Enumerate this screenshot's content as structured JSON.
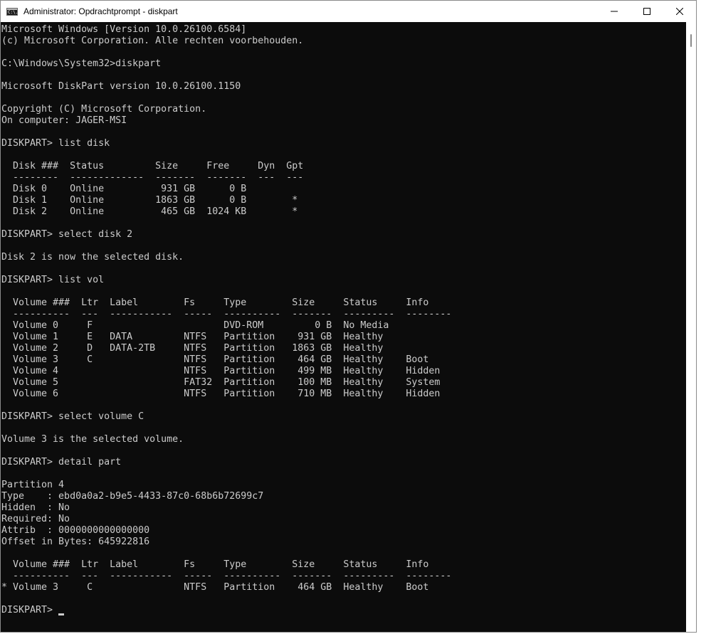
{
  "window": {
    "title": "Administrator: Opdrachtprompt - diskpart",
    "icon_label": "C:\\."
  },
  "console": {
    "lines": [
      "Microsoft Windows [Version 10.0.26100.6584]",
      "(c) Microsoft Corporation. Alle rechten voorbehouden.",
      "",
      "C:\\Windows\\System32>diskpart",
      "",
      "Microsoft DiskPart version 10.0.26100.1150",
      "",
      "Copyright (C) Microsoft Corporation.",
      "On computer: JAGER-MSI",
      "",
      "DISKPART> list disk",
      "",
      "  Disk ###  Status         Size     Free     Dyn  Gpt",
      "  --------  -------------  -------  -------  ---  ---",
      "  Disk 0    Online          931 GB      0 B",
      "  Disk 1    Online         1863 GB      0 B        *",
      "  Disk 2    Online          465 GB  1024 KB        *",
      "",
      "DISKPART> select disk 2",
      "",
      "Disk 2 is now the selected disk.",
      "",
      "DISKPART> list vol",
      "",
      "  Volume ###  Ltr  Label        Fs     Type        Size     Status     Info",
      "  ----------  ---  -----------  -----  ----------  -------  ---------  --------",
      "  Volume 0     F                       DVD-ROM         0 B  No Media",
      "  Volume 1     E   DATA         NTFS   Partition    931 GB  Healthy",
      "  Volume 2     D   DATA-2TB     NTFS   Partition   1863 GB  Healthy",
      "  Volume 3     C                NTFS   Partition    464 GB  Healthy    Boot",
      "  Volume 4                      NTFS   Partition    499 MB  Healthy    Hidden",
      "  Volume 5                      FAT32  Partition    100 MB  Healthy    System",
      "  Volume 6                      NTFS   Partition    710 MB  Healthy    Hidden",
      "",
      "DISKPART> select volume C",
      "",
      "Volume 3 is the selected volume.",
      "",
      "DISKPART> detail part",
      "",
      "Partition 4",
      "Type    : ebd0a0a2-b9e5-4433-87c0-68b6b72699c7",
      "Hidden  : No",
      "Required: No",
      "Attrib  : 0000000000000000",
      "Offset in Bytes: 645922816",
      "",
      "  Volume ###  Ltr  Label        Fs     Type        Size     Status     Info",
      "  ----------  ---  -----------  -----  ----------  -------  ---------  --------",
      "* Volume 3     C                NTFS   Partition    464 GB  Healthy    Boot",
      ""
    ],
    "prompt": "DISKPART> "
  },
  "colors": {
    "background": "#0c0c0c",
    "foreground": "#cccccc",
    "titlebar": "#ffffff"
  },
  "icons": {
    "app": "console-icon",
    "minimize": "minimize-icon",
    "maximize": "maximize-icon",
    "close": "close-icon"
  }
}
